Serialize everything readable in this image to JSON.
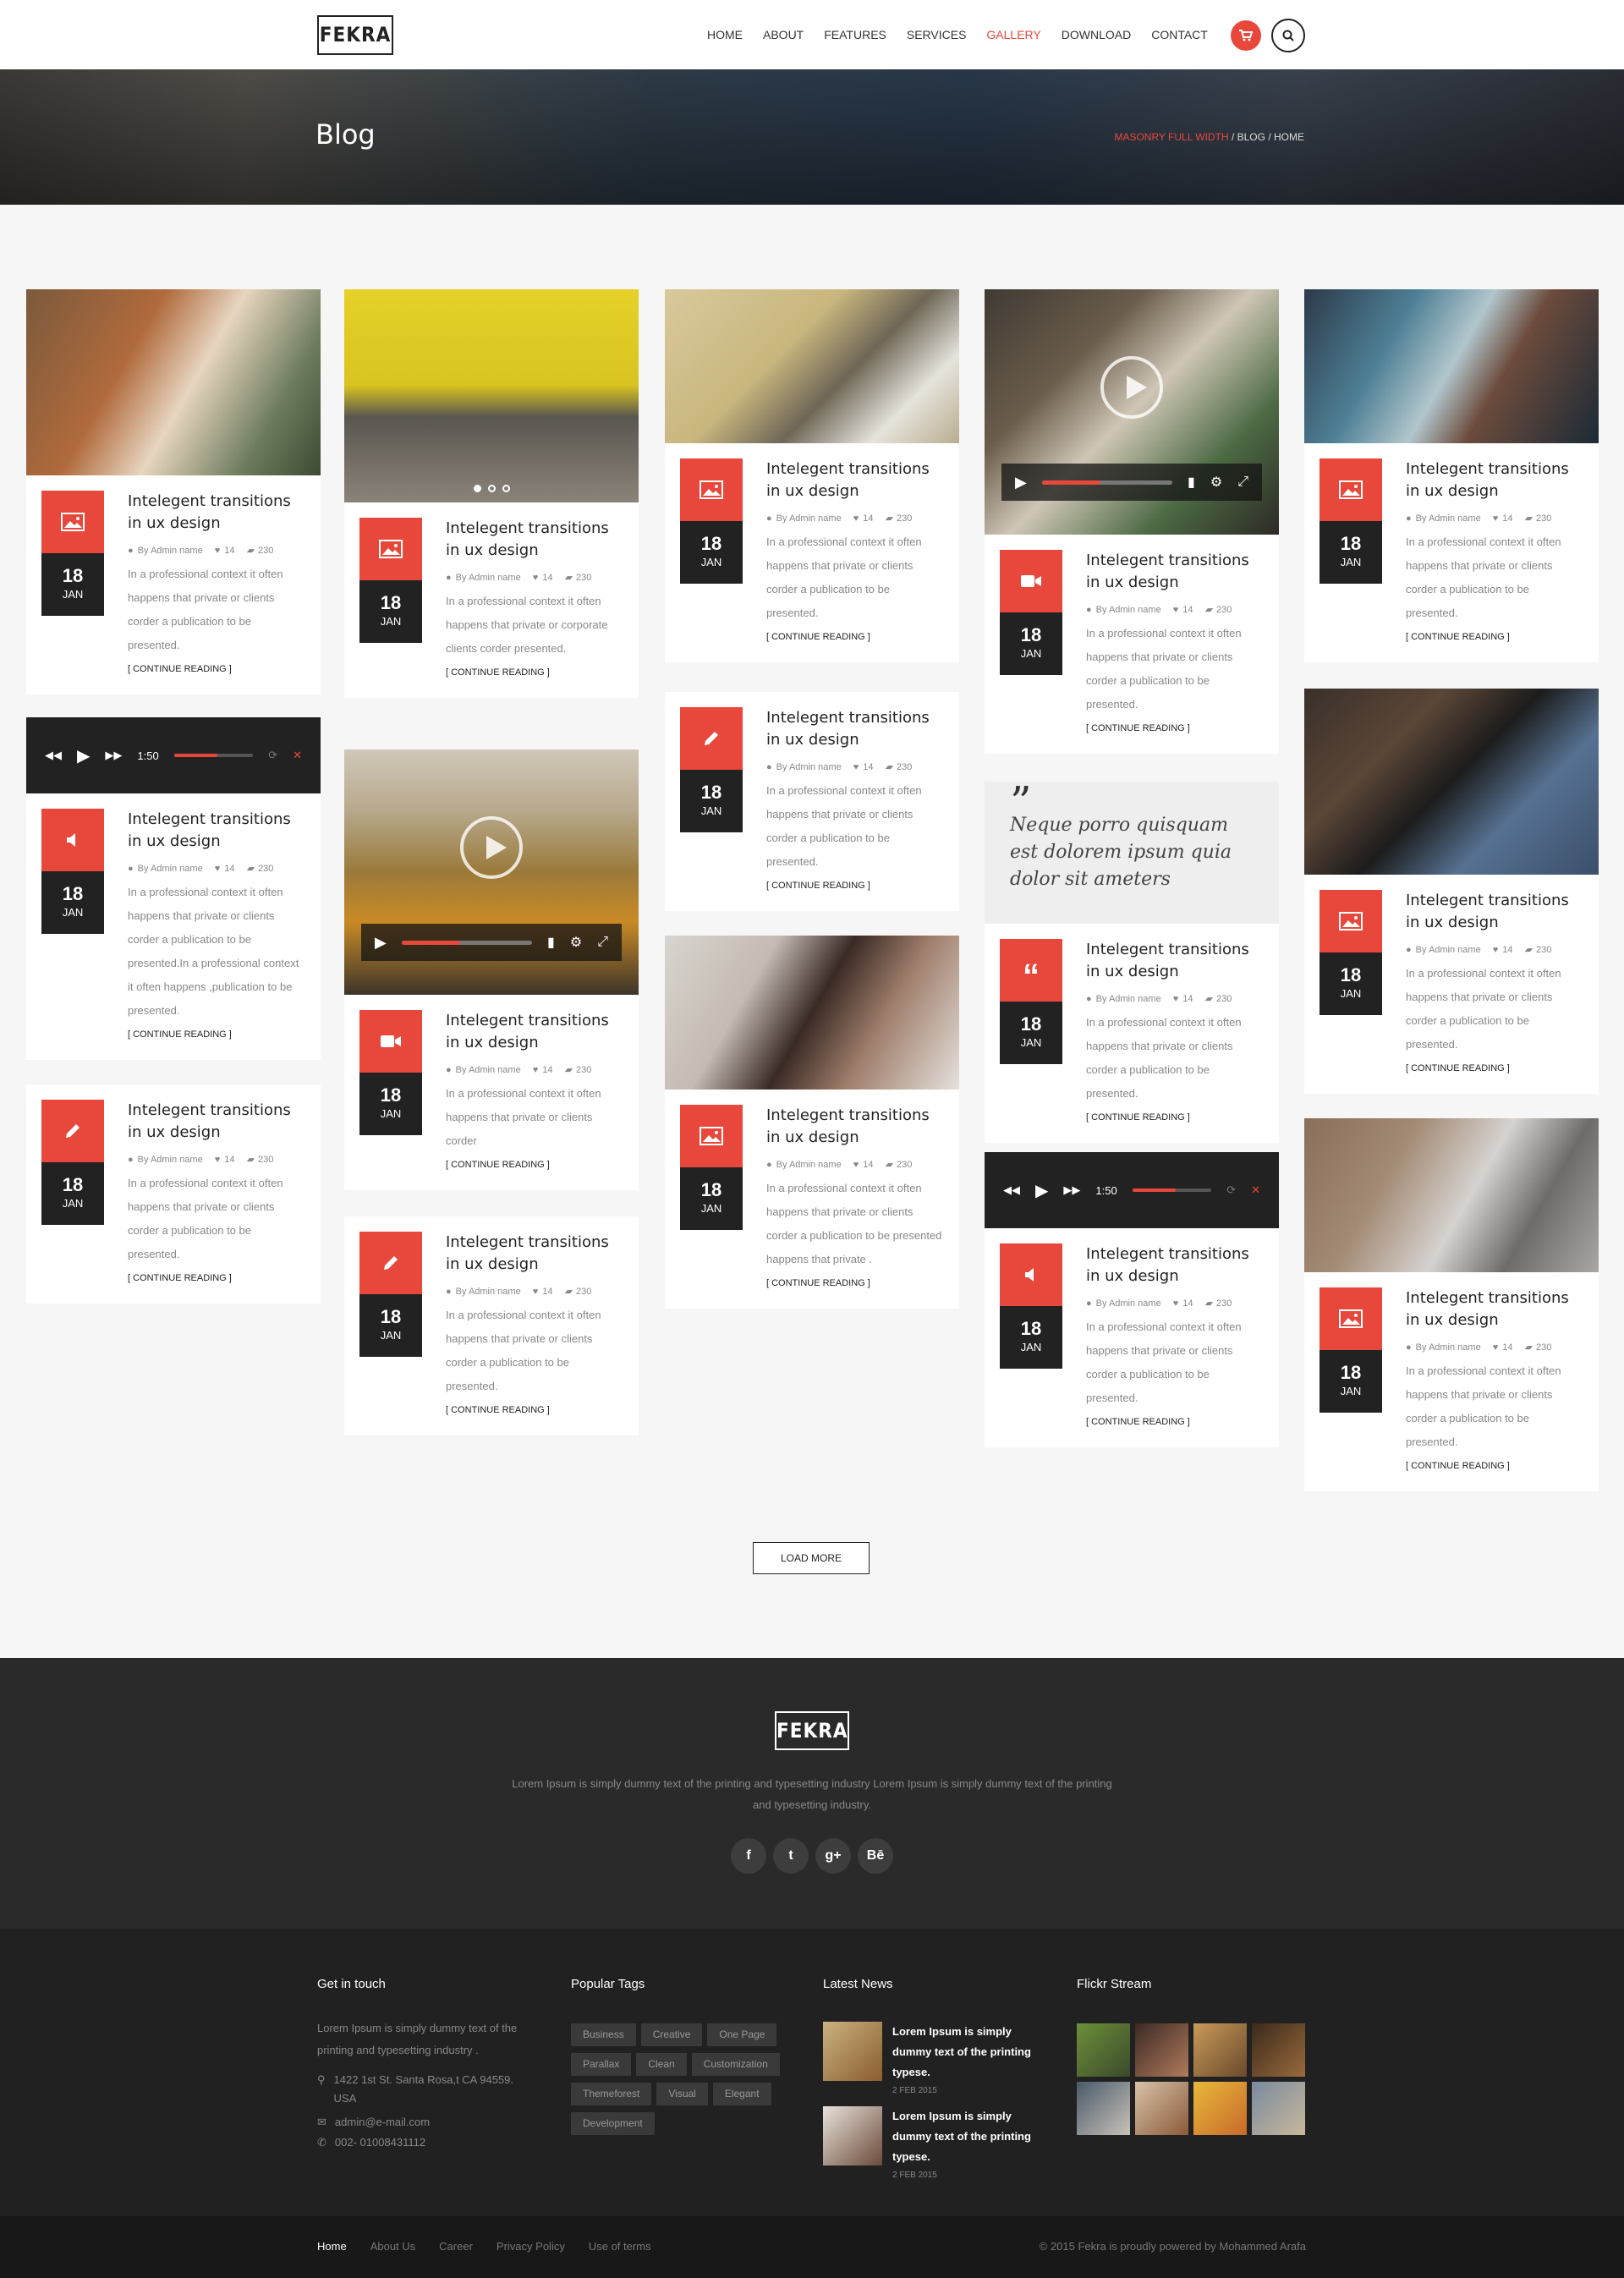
{
  "brand": {
    "logo": "FEKRA"
  },
  "nav": {
    "items": [
      "HOME",
      "ABOUT",
      "FEATURES",
      "SERVICES",
      "GALLERY",
      "DOWNLOAD",
      "CONTACT"
    ],
    "active": "GALLERY"
  },
  "hero": {
    "title": "Blog",
    "breadcrumb": {
      "current": "MASONRY FULL WIDTH",
      "sep1": " / ",
      "p1": "BLOG",
      "sep2": " / ",
      "p2": "HOME"
    }
  },
  "post": {
    "title": "Intelegent transitions in ux design",
    "author": "By Admin name",
    "likes": "14",
    "comments": "230",
    "day": "18",
    "month": "JAN",
    "more": "[ CONTINUE READING ]",
    "excerpt_short": "In a professional context it often happens that private or clients corder a publication to be presented.",
    "excerpt_long": "In a professional context it often happens that private or clients corder a publication to be presented.In a professional context it often happens ,publication to be presented.",
    "excerpt_corp": "In a professional context it often happens that private or corporate clients corder presented.",
    "excerpt_brief": "In a professional context it often happens that private or clients corder",
    "excerpt_private": "In a professional context it often happens that private or clients corder a publication to be presented happens that private ."
  },
  "audio": {
    "time": "1:50"
  },
  "quote": {
    "text": "Neque porro quisquam est dolorem ipsum quia dolor sit ameters"
  },
  "load_more": "LOAD MORE",
  "footer": {
    "logo": "FEKRA",
    "desc": "Lorem Ipsum is simply dummy text of the printing and typesetting industry Lorem Ipsum is simply dummy text of the printing and typesetting industry.",
    "socials": [
      "f",
      "t",
      "g+",
      "Bē"
    ],
    "get_in_touch": {
      "title": "Get in touch",
      "text": "Lorem Ipsum is simply dummy text of the printing and typesetting industry .",
      "address": "1422 1st St. Santa Rosa,t CA 94559. USA",
      "email": "admin@e-mail.com",
      "phone": "002- 01008431112"
    },
    "tags": {
      "title": "Popular Tags",
      "items": [
        "Business",
        "Creative",
        "One Page",
        "Parallax",
        "Clean",
        "Customization",
        "Themeforest",
        "Visual",
        "Elegant",
        "Development"
      ]
    },
    "news": {
      "title": "Latest News",
      "items": [
        {
          "title": "Lorem Ipsum is simply dummy text of the printing typese.",
          "date": "2 FEB 2015"
        },
        {
          "title": "Lorem Ipsum is simply dummy text of the printing typese.",
          "date": "2 FEB 2015"
        }
      ]
    },
    "flickr": {
      "title": "Flickr Stream"
    },
    "links": [
      "Home",
      "About Us",
      "Career",
      "Privacy Policy",
      "Use of terms"
    ],
    "copyright": "© 2015 Fekra  is proudly powered by  Mohammed Arafa"
  },
  "colors": {
    "accent": "#e8483c",
    "dark": "#222222"
  }
}
